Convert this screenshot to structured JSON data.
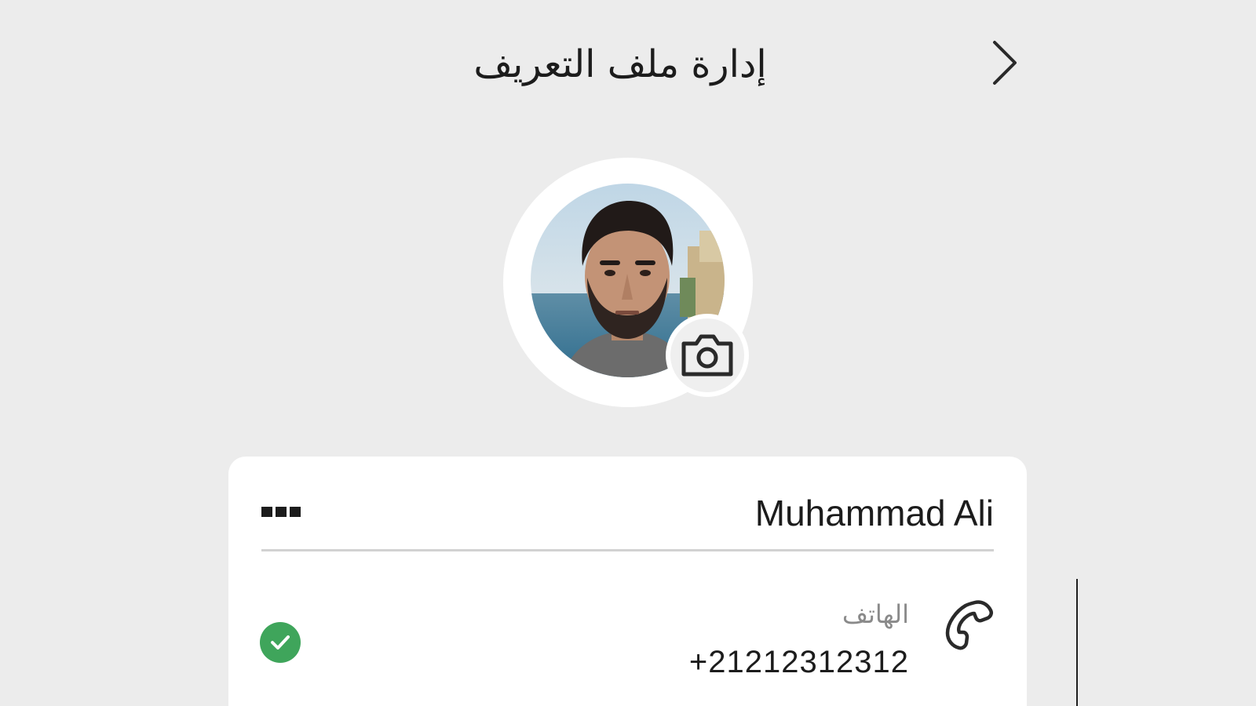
{
  "header": {
    "title": "إدارة ملف التعريف",
    "back_icon": "chevron-right-icon"
  },
  "profile": {
    "avatar_alt": "Profile photo",
    "camera_icon": "camera-icon"
  },
  "card": {
    "name": "Muhammad Ali",
    "more_icon": "more-icon",
    "phone_label": "الهاتف",
    "phone_value": "+21212312312",
    "phone_icon": "phone-icon",
    "verified_icon": "check-icon",
    "verified_color": "#3fa55b"
  },
  "colors": {
    "background": "#ececec",
    "card": "#ffffff",
    "text": "#1c1c1c",
    "muted": "#8a8a8a"
  }
}
